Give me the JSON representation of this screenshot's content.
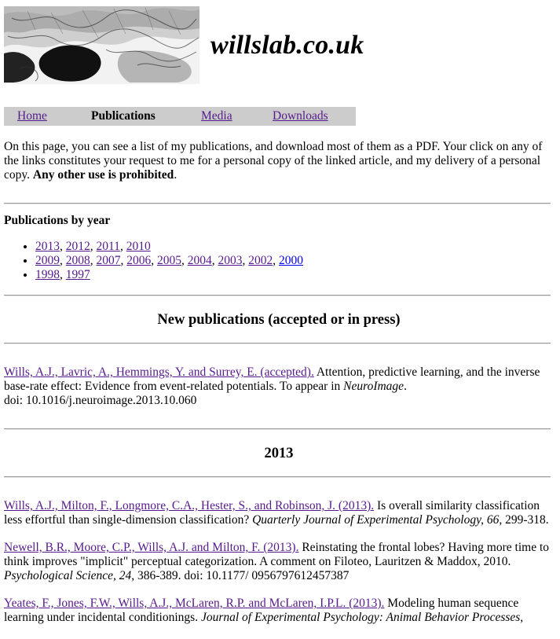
{
  "site": {
    "title": "willslab.co.uk",
    "logo_icon": "brain-illustration"
  },
  "nav": {
    "items": [
      {
        "label": "Home",
        "current": false
      },
      {
        "label": "Publications",
        "current": true
      },
      {
        "label": "Media",
        "current": false
      },
      {
        "label": "Downloads",
        "current": false
      }
    ]
  },
  "intro": {
    "text": "On this page, you can see a list of my publications, and download most of them as a PDF. Your click on any of the links constitutes your request to me for a personal copy of the linked article, and my delivery of a personal copy.",
    "bold": "Any other use is prohibited",
    "end": "."
  },
  "by_year": {
    "title": "Publications by year",
    "rows": [
      [
        "2013",
        "2012",
        "2011",
        "2010"
      ],
      [
        "2009",
        "2008",
        "2007",
        "2006",
        "2005",
        "2004",
        "2003",
        "2002",
        "2000"
      ],
      [
        "1998",
        "1997"
      ]
    ]
  },
  "sections": {
    "new": "New publications (accepted or in press)",
    "y2013": "2013"
  },
  "pubs": {
    "p1": {
      "link": "Wills, A.J., Lavric, A., Hemmings, Y. and Surrey, E. (accepted).",
      "text": " Attention, predictive learning, and the inverse base-rate effect: Evidence from event-related potentials. To appear in ",
      "journal": "NeuroImage",
      "tail": ".",
      "doi": "doi:  10.1016/j.neuroimage.2013.10.060"
    },
    "p2": {
      "link": "Wills, A.J., Milton, F., Longmore, C.A., Hester, S., and Robinson, J. (2013).",
      "text": " Is overall similarity classification less effortful than single-dimension classification? ",
      "journal": "Quarterly Journal of Experimental Psychology, 66,",
      "tail": "  299-318."
    },
    "p3": {
      "link": "Newell, B.R., Moore, C.P., Wills, A.J. and Milton, F. (2013).",
      "text": " Reinstating the frontal lobes? Having more time to think improves \"implicit\" perceptual categorization. A comment on Filoteo, Lauritzen & Maddox, 2010. ",
      "journal": "Psychological Science, 24,",
      "tail": " 386-389. doi: 10.1177/ 0956797612457387"
    },
    "p4": {
      "link": "Yeates, F., Jones, F.W., Wills, A.J., McLaren, R.P. and McLaren, I.P.L. (2013).",
      "text": " Modeling human sequence learning under incidental conditionings. ",
      "journal": "Journal of Experimental Psychology: Animal Behavior Processes,"
    }
  }
}
